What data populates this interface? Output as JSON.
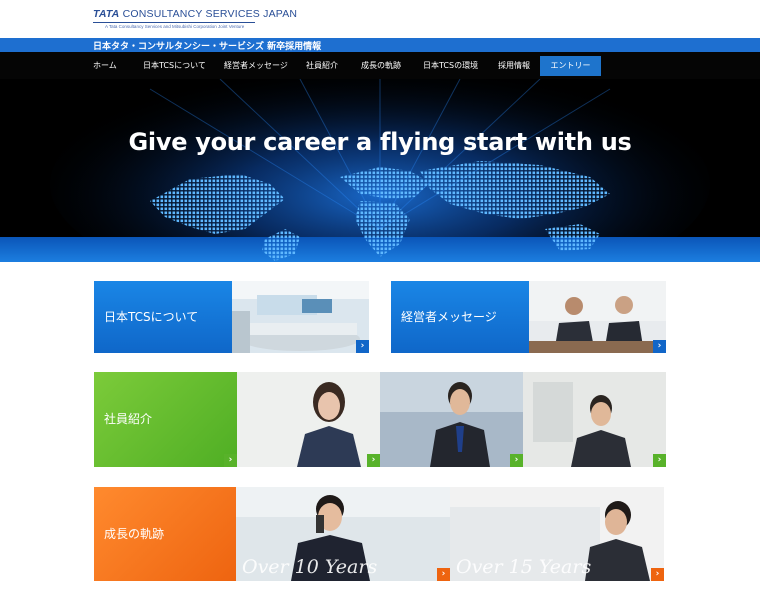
{
  "header": {
    "logo_main_bold": "TATA",
    "logo_main_rest": " CONSULTANCY SERVICES JAPAN",
    "logo_sub": "A Tata Consultancy Services and Mitsubishi Corporation Joint Venture",
    "site_title": "日本タタ・コンサルタンシー・サービシズ 新卒採用情報"
  },
  "nav": {
    "items": [
      "ホーム",
      "日本TCSについて",
      "経営者メッセージ",
      "社員紹介",
      "成長の軌跡",
      "日本TCSの環境",
      "採用情報"
    ],
    "entry": "エントリー"
  },
  "hero": {
    "title": "Give your career a flying start with us"
  },
  "tiles": {
    "about": "日本TCSについて",
    "message": "経営者メッセージ",
    "staff": "社員紹介",
    "growth": "成長の軌跡",
    "over10": "Over 10 Years",
    "over15": "Over 15 Years"
  },
  "colors": {
    "brand_blue": "#1e6fd0",
    "tile_blue": "#1476d8",
    "tile_green": "#5fba2c",
    "tile_orange": "#f06d1a",
    "nav_bg": "#050505"
  }
}
